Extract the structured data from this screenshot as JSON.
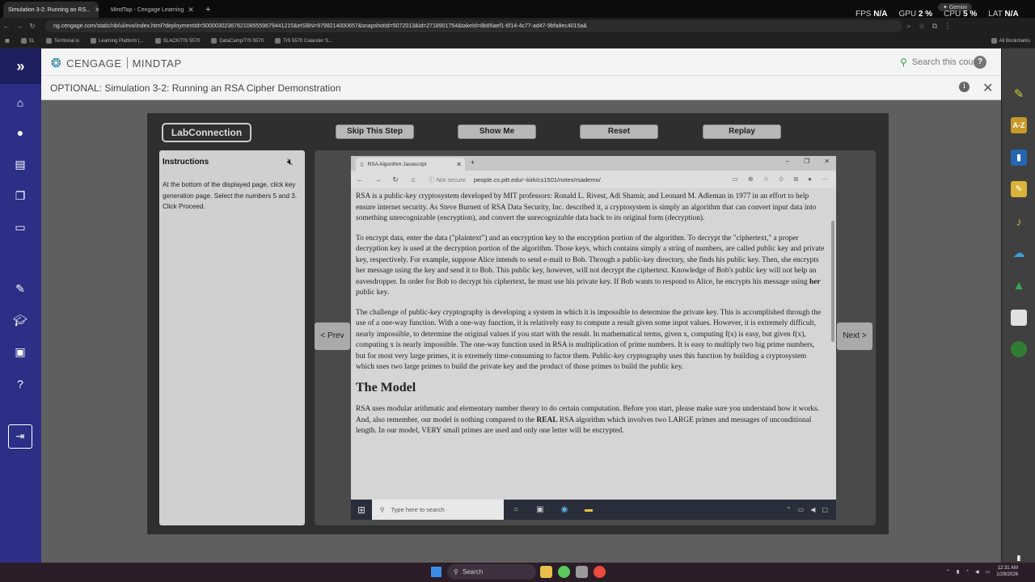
{
  "browser": {
    "tabs": [
      {
        "label": "Simulation 3-2: Running an RS..."
      },
      {
        "label": "MindTap - Cengage Learning"
      }
    ],
    "gemini": "Gemini",
    "stats": [
      {
        "label": "FPS",
        "value": "N/A"
      },
      {
        "label": "GPU",
        "value": "2 %"
      },
      {
        "label": "CPU",
        "value": "5 %"
      },
      {
        "label": "LAT",
        "value": "N/A"
      }
    ],
    "url": "ng.cengage.com/static/nb/ui/evo/index.html?deploymentId=50000302367621085559679441215&eISBN=9798214000657&snapshotId=5072013&id=2718901754&takeId=8b85aef1-6f14-4c77-ad47-9bfa8ec4015a&",
    "bookmarks": [
      "SL",
      "Territorial.io",
      "Learning Platform |...",
      "SLACK/TIS 5570",
      "DataCamp/TIS 5570",
      "TIS 5570 Calander S..."
    ],
    "all_bookmarks": "All Bookmarks"
  },
  "header": {
    "brand": "CENGAGE",
    "product": "MINDTAP",
    "search_placeholder": "Search this course"
  },
  "activity": {
    "title": "OPTIONAL: Simulation 3-2: Running an RSA Cipher Demonstration"
  },
  "lab": {
    "logo": "LabConnection",
    "buttons": {
      "skip": "Skip This Step",
      "show": "Show Me",
      "reset": "Reset",
      "replay": "Replay"
    },
    "instructions_title": "Instructions",
    "instructions_text": "At the bottom of the displayed page, click key generation page. Select the numbers 5 and 3. Click Proceed.",
    "prev": "< Prev",
    "next": "Next >"
  },
  "inner_browser": {
    "tab_title": "RSA Algorithm Javascript",
    "not_secure": "Not secure",
    "url": "people.cs.pitt.edu/~kirk/cs1501/notes/rsademo/",
    "search_placeholder": "Type here to search",
    "page": {
      "p1": "RSA is a public-key cryptosystem developed by MIT professors: Ronald L. Rivest, Adi Shamir, and Leonard M. Adleman in 1977 in an effort to help ensure internet security. As Steve Burnett of RSA Data Security, Inc. described it, a cryptosystem is simply an algorithm that can convert input data into something unrecognizable (encryption), and convert the unrecognizable data back to its original form (decryption).",
      "p2a": "To encrypt data, enter the data (\"plaintext\") and an encryption key to the encryption portion of the algorithm. To decrypt the \"ciphertext,\" a proper decryption key is used at the decryption portion of the algorithm. Those keys, which contains simply a string of numbers, are called public key and private key, respectively. For example, suppose Alice intends to send e-mail to Bob. Through a public-key directory, she finds his public key. Then, she encrypts her message using the key and send it to Bob. This public key, however, will not decrypt the ciphertext. Knowledge of Bob's public key will not help an eavesdropper. In order for Bob to decrypt his ciphertext, he must use his private key. If Bob wants to respond to Alice, he encrypts his message using ",
      "p2b": "her",
      "p2c": " public key.",
      "p3": "The challenge of public-key cryptography is developing a system in which it is impossible to determine the private key. This is accomplished through the use of a one-way function. With a one-way function, it is relatively easy to compute a result given some input values. However, it is extremely difficult, nearly impossible, to determine the original values if you start with the result. In mathematical terms, given x, computing f(x) is easy, but given f(x), computing x is nearly impossible. The one-way function used in RSA is multiplication of prime numbers. It is easy to multiply two big prime numbers, but for most very large primes, it is exremely time-consuming to factor them. Public-key cryptography uses this function by building a cryptosystem which uses two large primes to build the private key and the product of those primes to build the public key.",
      "heading": "The Model",
      "p4a": "RSA uses modular arithmatic and elementary number theory to do certain computation. Before you start, please make sure you understand how it works. And, also remember, our model is nothing compared to the ",
      "p4b": "REAL",
      "p4c": " RSA algorithm which involves two LARGE primes and messages of unconditional length. In our model, VERY small primes are used and only one letter will be encrypted."
    }
  },
  "right_rail": {
    "az_label": "A-Z"
  },
  "os_taskbar": {
    "search": "Search",
    "time": "12:31 AM",
    "date": "1/29/2026"
  }
}
